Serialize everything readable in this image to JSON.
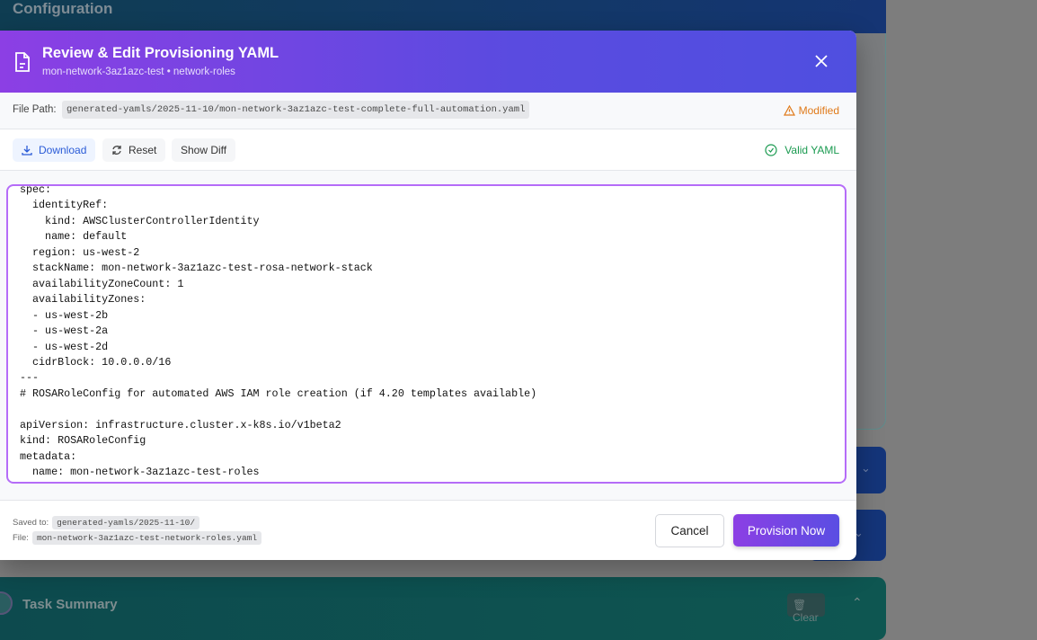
{
  "background": {
    "configuration_title": "Configuration",
    "task_summary_title": "Task Summary",
    "clear_label": "Clear"
  },
  "modal": {
    "title": "Review & Edit Provisioning YAML",
    "subtitle": "mon-network-3az1azc-test • network-roles",
    "file_path_label": "File Path:",
    "file_path": "generated-yamls/2025-11-10/mon-network-3az1azc-test-complete-full-automation.yaml",
    "status_modified": "Modified",
    "toolbar": {
      "download": "Download",
      "reset": "Reset",
      "show_diff": "Show Diff",
      "valid": "Valid YAML"
    },
    "yaml_content": "spec:\n  identityRef:\n    kind: AWSClusterControllerIdentity\n    name: default\n  region: us-west-2\n  stackName: mon-network-3az1azc-test-rosa-network-stack\n  availabilityZoneCount: 1\n  availabilityZones:\n  - us-west-2b\n  - us-west-2a\n  - us-west-2d\n  cidrBlock: 10.0.0.0/16\n---\n# ROSARoleConfig for automated AWS IAM role creation (if 4.20 templates available)\n\napiVersion: infrastructure.cluster.x-k8s.io/v1beta2\nkind: ROSARoleConfig\nmetadata:\n  name: mon-network-3az1azc-test-roles",
    "footer": {
      "saved_to_label": "Saved to:",
      "saved_to": "generated-yamls/2025-11-10/",
      "file_label": "File:",
      "file": "mon-network-3az1azc-test-network-roles.yaml",
      "cancel": "Cancel",
      "provision": "Provision Now"
    }
  },
  "colors": {
    "accent": "#8c3fe4",
    "modified": "#e07a1a",
    "valid": "#1a9a50"
  }
}
